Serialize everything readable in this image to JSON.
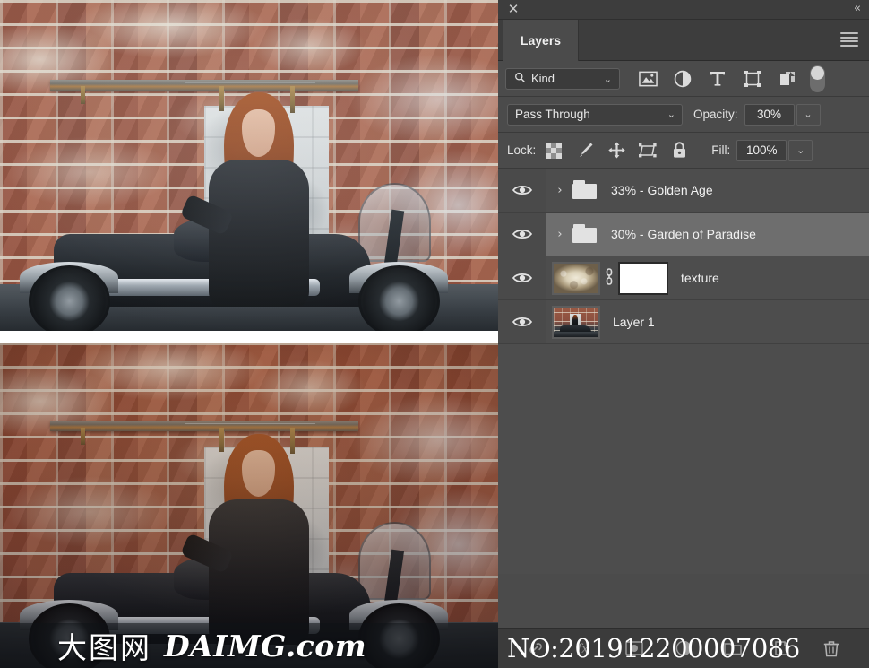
{
  "photos": {
    "before_caption": "before-retouch-preview",
    "after_caption": "after-retouch-preview"
  },
  "watermark": {
    "cn": "大图网",
    "en": "DAIMG.com"
  },
  "panel": {
    "close_label": "✕",
    "collapse_label": "«",
    "tab_label": "Layers",
    "menu_label": "panel-menu"
  },
  "filter": {
    "kind_label": "Kind",
    "search_icon": "search-icon",
    "caret": "⌄",
    "icons": [
      {
        "name": "filter-pixel-layers-icon",
        "glyph": "image"
      },
      {
        "name": "filter-adjustment-layers-icon",
        "glyph": "half-circle"
      },
      {
        "name": "filter-type-layers-icon",
        "glyph": "T"
      },
      {
        "name": "filter-shape-layers-icon",
        "glyph": "shape"
      },
      {
        "name": "filter-smart-object-icon",
        "glyph": "smart"
      }
    ],
    "toggle_label": "filter-enable-toggle"
  },
  "blend": {
    "mode": "Pass Through",
    "caret": "⌄",
    "opacity_label": "Opacity:",
    "opacity_value": "30%",
    "fill_label": "Fill:",
    "fill_value": "100%"
  },
  "lock": {
    "label": "Lock:",
    "icons": [
      {
        "name": "lock-transparent-pixels-icon"
      },
      {
        "name": "lock-image-pixels-icon"
      },
      {
        "name": "lock-position-icon"
      },
      {
        "name": "lock-artboard-nesting-icon"
      },
      {
        "name": "lock-all-icon"
      }
    ]
  },
  "layers": [
    {
      "name": "33% - Golden Age",
      "type": "group",
      "visible": true,
      "selected": false,
      "disclosure": "›"
    },
    {
      "name": "30% - Garden of Paradise",
      "type": "group",
      "visible": true,
      "selected": true,
      "disclosure": "›"
    },
    {
      "name": "texture",
      "type": "masked-layer",
      "visible": true,
      "selected": false,
      "link_glyph": "⛓"
    },
    {
      "name": "Layer 1",
      "type": "pixel-layer",
      "visible": true,
      "selected": false
    }
  ],
  "bottom_toolbar": {
    "icons": [
      {
        "name": "link-layers-icon",
        "glyph": "link"
      },
      {
        "name": "layer-style-fx-icon",
        "glyph": "fx"
      },
      {
        "name": "add-layer-mask-icon",
        "glyph": "mask"
      },
      {
        "name": "new-adjustment-layer-icon",
        "glyph": "adjust"
      },
      {
        "name": "new-group-icon",
        "glyph": "folder"
      },
      {
        "name": "new-layer-icon",
        "glyph": "newlayer"
      },
      {
        "name": "delete-layer-icon",
        "glyph": "trash"
      }
    ]
  },
  "stock_number": "NO:201912200007086",
  "colors": {
    "panel_bg": "#4b4b4b",
    "row_bg": "#4d4d4d",
    "row_selected": "#6e6e6e",
    "field_bg": "#3e3e3e",
    "text": "#e6e6e6",
    "toolbar_bg": "#3b3b3b"
  }
}
